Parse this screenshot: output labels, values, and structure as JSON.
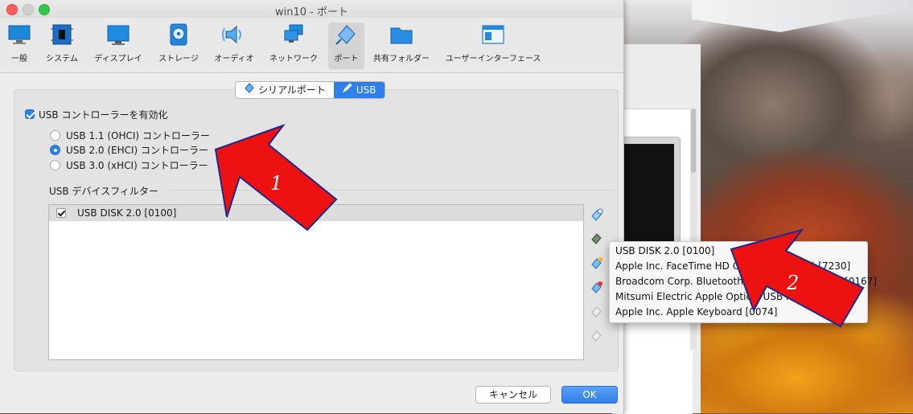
{
  "window": {
    "title": "win10 - ポート"
  },
  "toolbar": {
    "items": [
      {
        "label": "一般",
        "icon": "general-icon"
      },
      {
        "label": "システム",
        "icon": "system-chip-icon"
      },
      {
        "label": "ディスプレイ",
        "icon": "display-monitor-icon"
      },
      {
        "label": "ストレージ",
        "icon": "storage-disk-icon"
      },
      {
        "label": "オーディオ",
        "icon": "audio-speaker-icon"
      },
      {
        "label": "ネットワーク",
        "icon": "network-icon"
      },
      {
        "label": "ポート",
        "icon": "port-plug-icon",
        "selected": true
      },
      {
        "label": "共有フォルダー",
        "icon": "shared-folder-icon"
      },
      {
        "label": "ユーザーインターフェース",
        "icon": "user-interface-icon"
      }
    ]
  },
  "tabs": [
    {
      "label": "シリアルポート",
      "icon": "serial-port-icon"
    },
    {
      "label": "USB",
      "icon": "usb-pen-icon",
      "active": true
    }
  ],
  "usb": {
    "enable_label": "USB コントローラーを有効化",
    "enabled": true,
    "controllers": [
      {
        "label": "USB 1.1 (OHCI) コントローラー",
        "selected": false
      },
      {
        "label": "USB 2.0 (EHCI) コントローラー",
        "selected": true
      },
      {
        "label": "USB 3.0 (xHCI) コントローラー",
        "selected": false
      }
    ],
    "filters_label": "USB デバイスフィルター",
    "filters": [
      {
        "label": "USB DISK 2.0 [0100]",
        "checked": true
      }
    ]
  },
  "popup_menu": {
    "items": [
      "USB DISK 2.0 [0100]",
      "Apple Inc. FaceTime HD Camera (Built-in) [7230]",
      "Broadcom Corp. Bluetooth USB Host Controller [0167]",
      "Mitsumi Electric Apple Optical USB Mouse [0110]",
      "Apple Inc. Apple Keyboard [0074]"
    ]
  },
  "annotations": {
    "first": "1",
    "second": "2"
  },
  "buttons": {
    "cancel": "キャンセル",
    "ok": "OK"
  },
  "colors": {
    "accent": "#2f7fe8",
    "annotation_arrow": "#ee1111"
  }
}
